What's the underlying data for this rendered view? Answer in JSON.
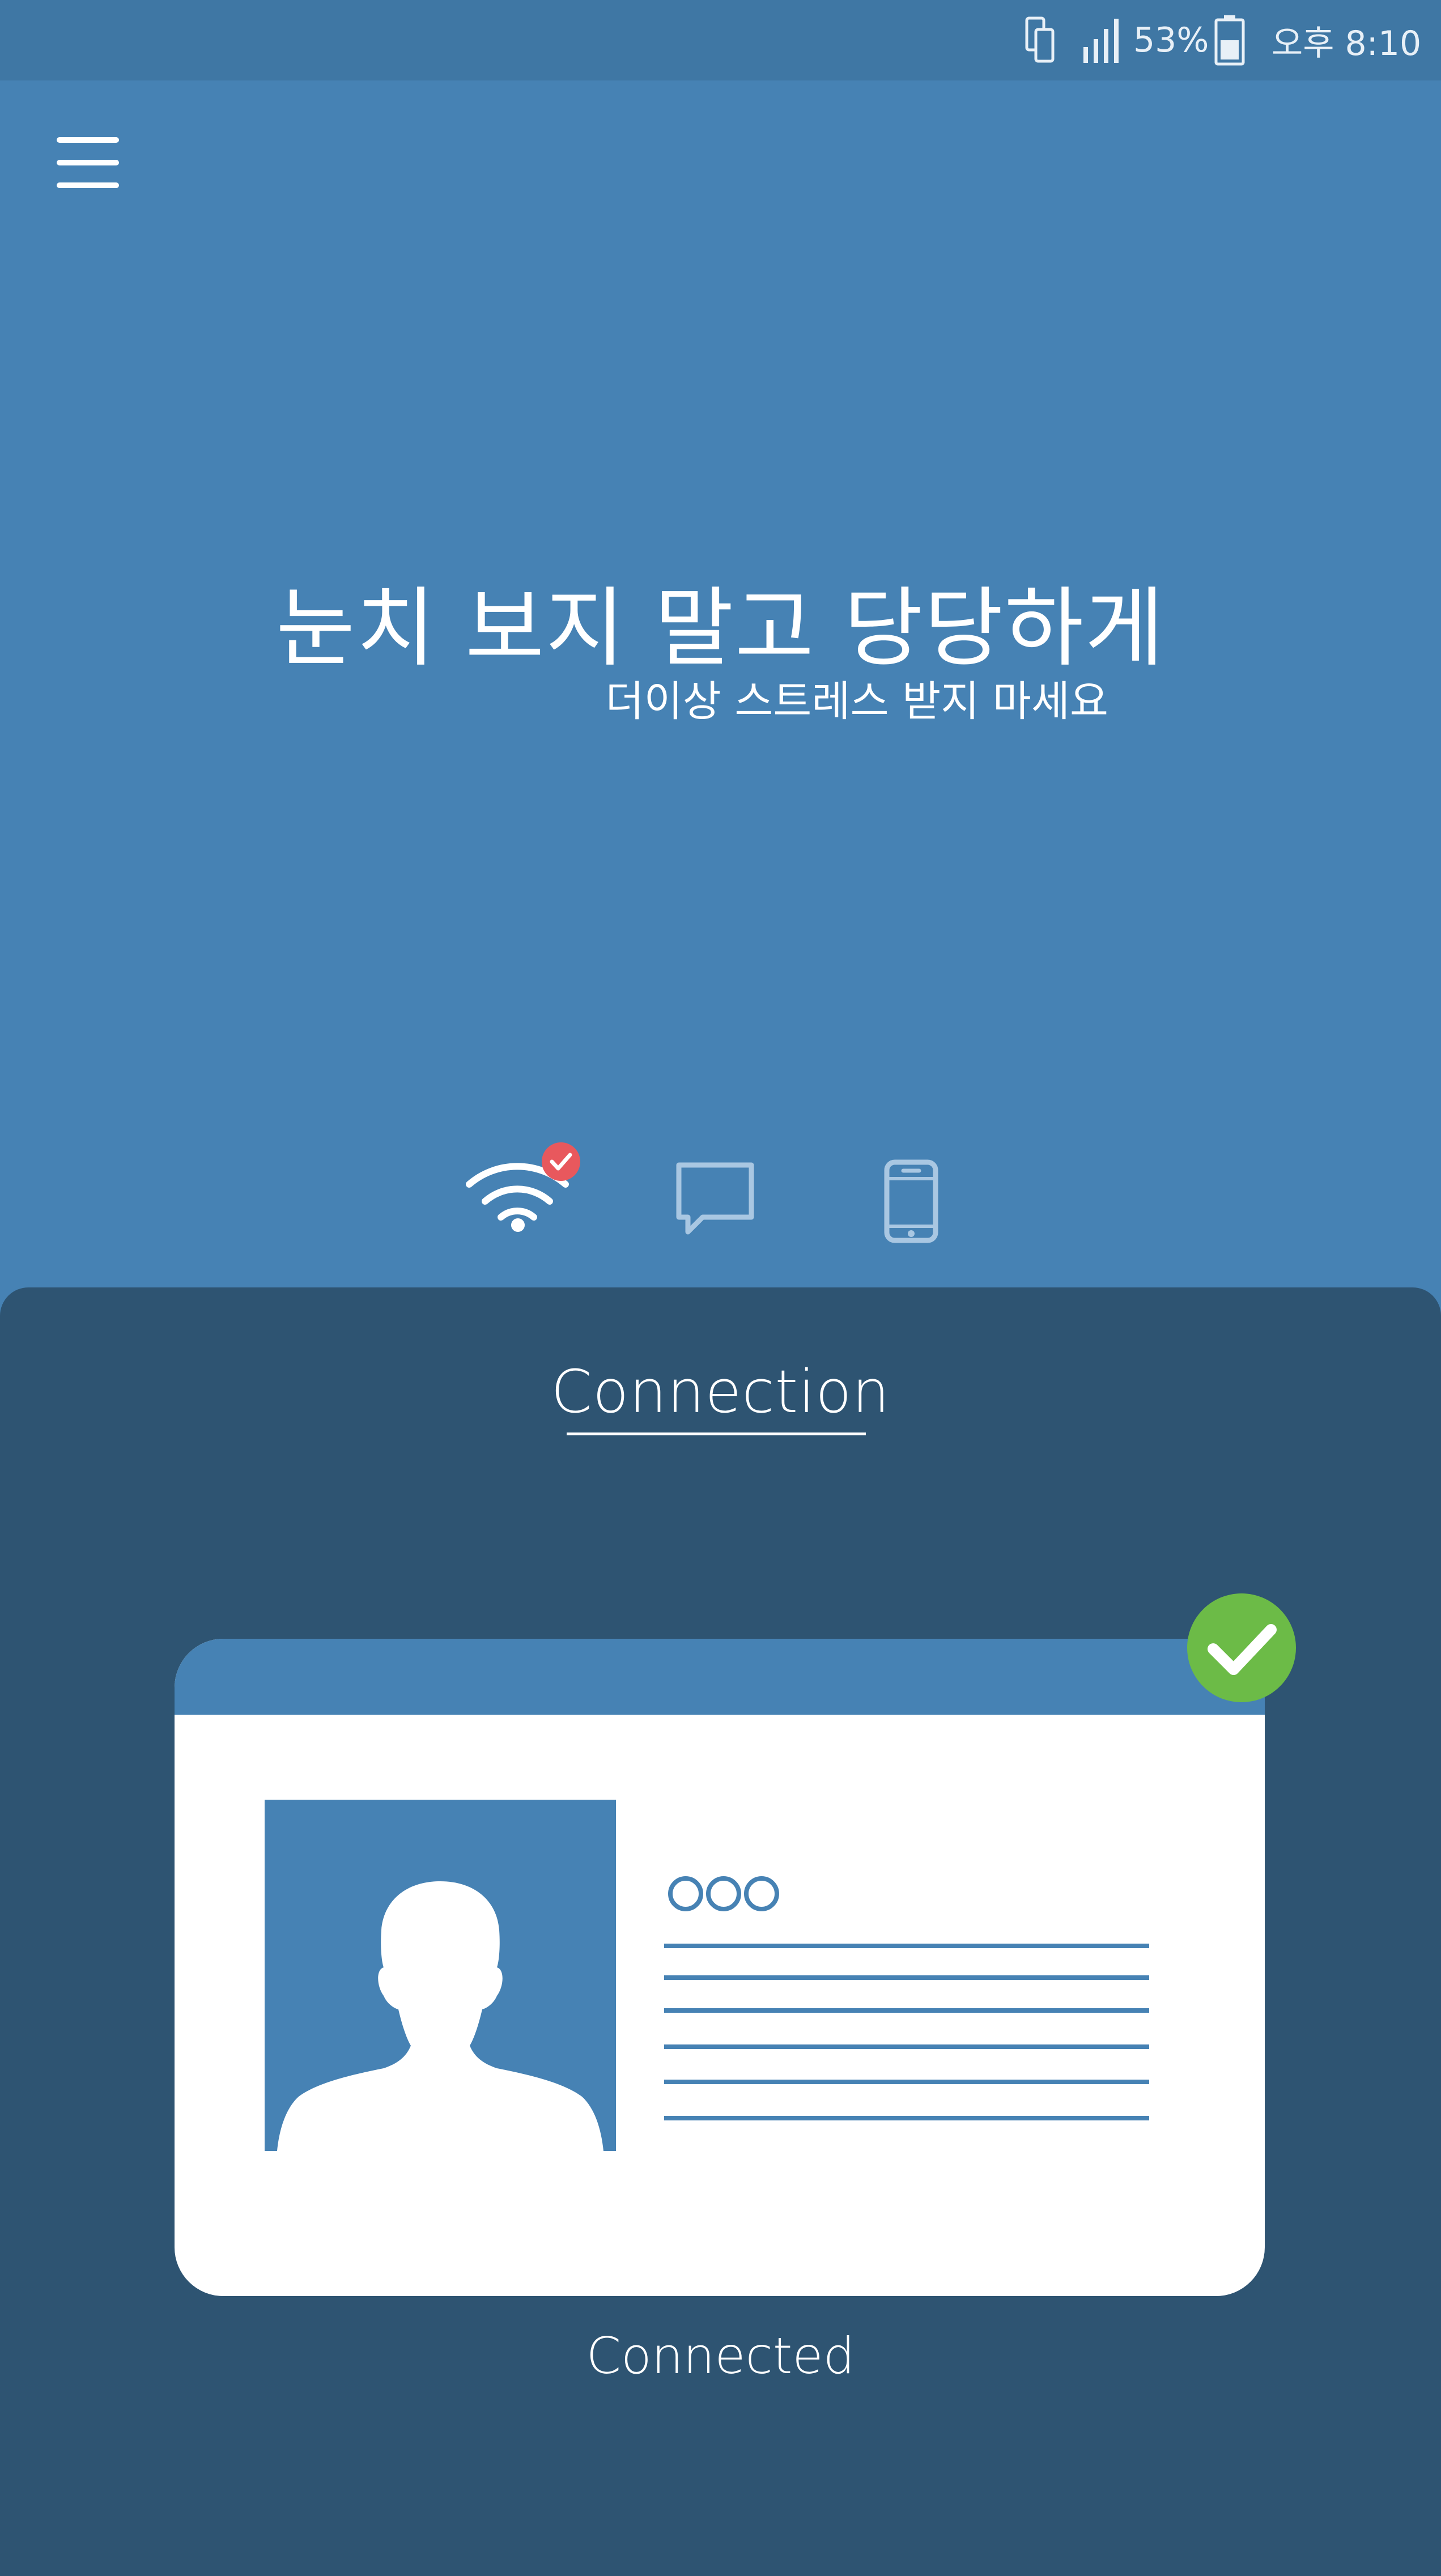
{
  "status_bar": {
    "icons": [
      "phone-link-icon",
      "signal-icon",
      "battery-icon"
    ],
    "battery_percent": "53%",
    "time": "오후 8:10"
  },
  "header": {
    "menu_icon": "hamburger-menu-icon",
    "headline": "눈치 보지 말고 당당하게",
    "subheadline": "더이상 스트레스 받지 마세요"
  },
  "tabs": [
    {
      "icon": "wifi-icon",
      "active": true,
      "badge_icon": "check-badge-icon"
    },
    {
      "icon": "chat-bubble-icon",
      "active": false
    },
    {
      "icon": "smartphone-icon",
      "active": false
    }
  ],
  "panel": {
    "title": "Connection",
    "card": {
      "photo_icon": "user-silhouette-icon",
      "name_placeholder": "○○○",
      "line_count": 6,
      "verified_icon": "green-check-icon"
    },
    "status": "Connected"
  },
  "colors": {
    "primary": "#4682b4",
    "status_bar": "#3f77a4",
    "panel": "#2e5472",
    "accent_red": "#e8585d",
    "success_green": "#6cbb47",
    "card_bg": "#ffffff"
  }
}
